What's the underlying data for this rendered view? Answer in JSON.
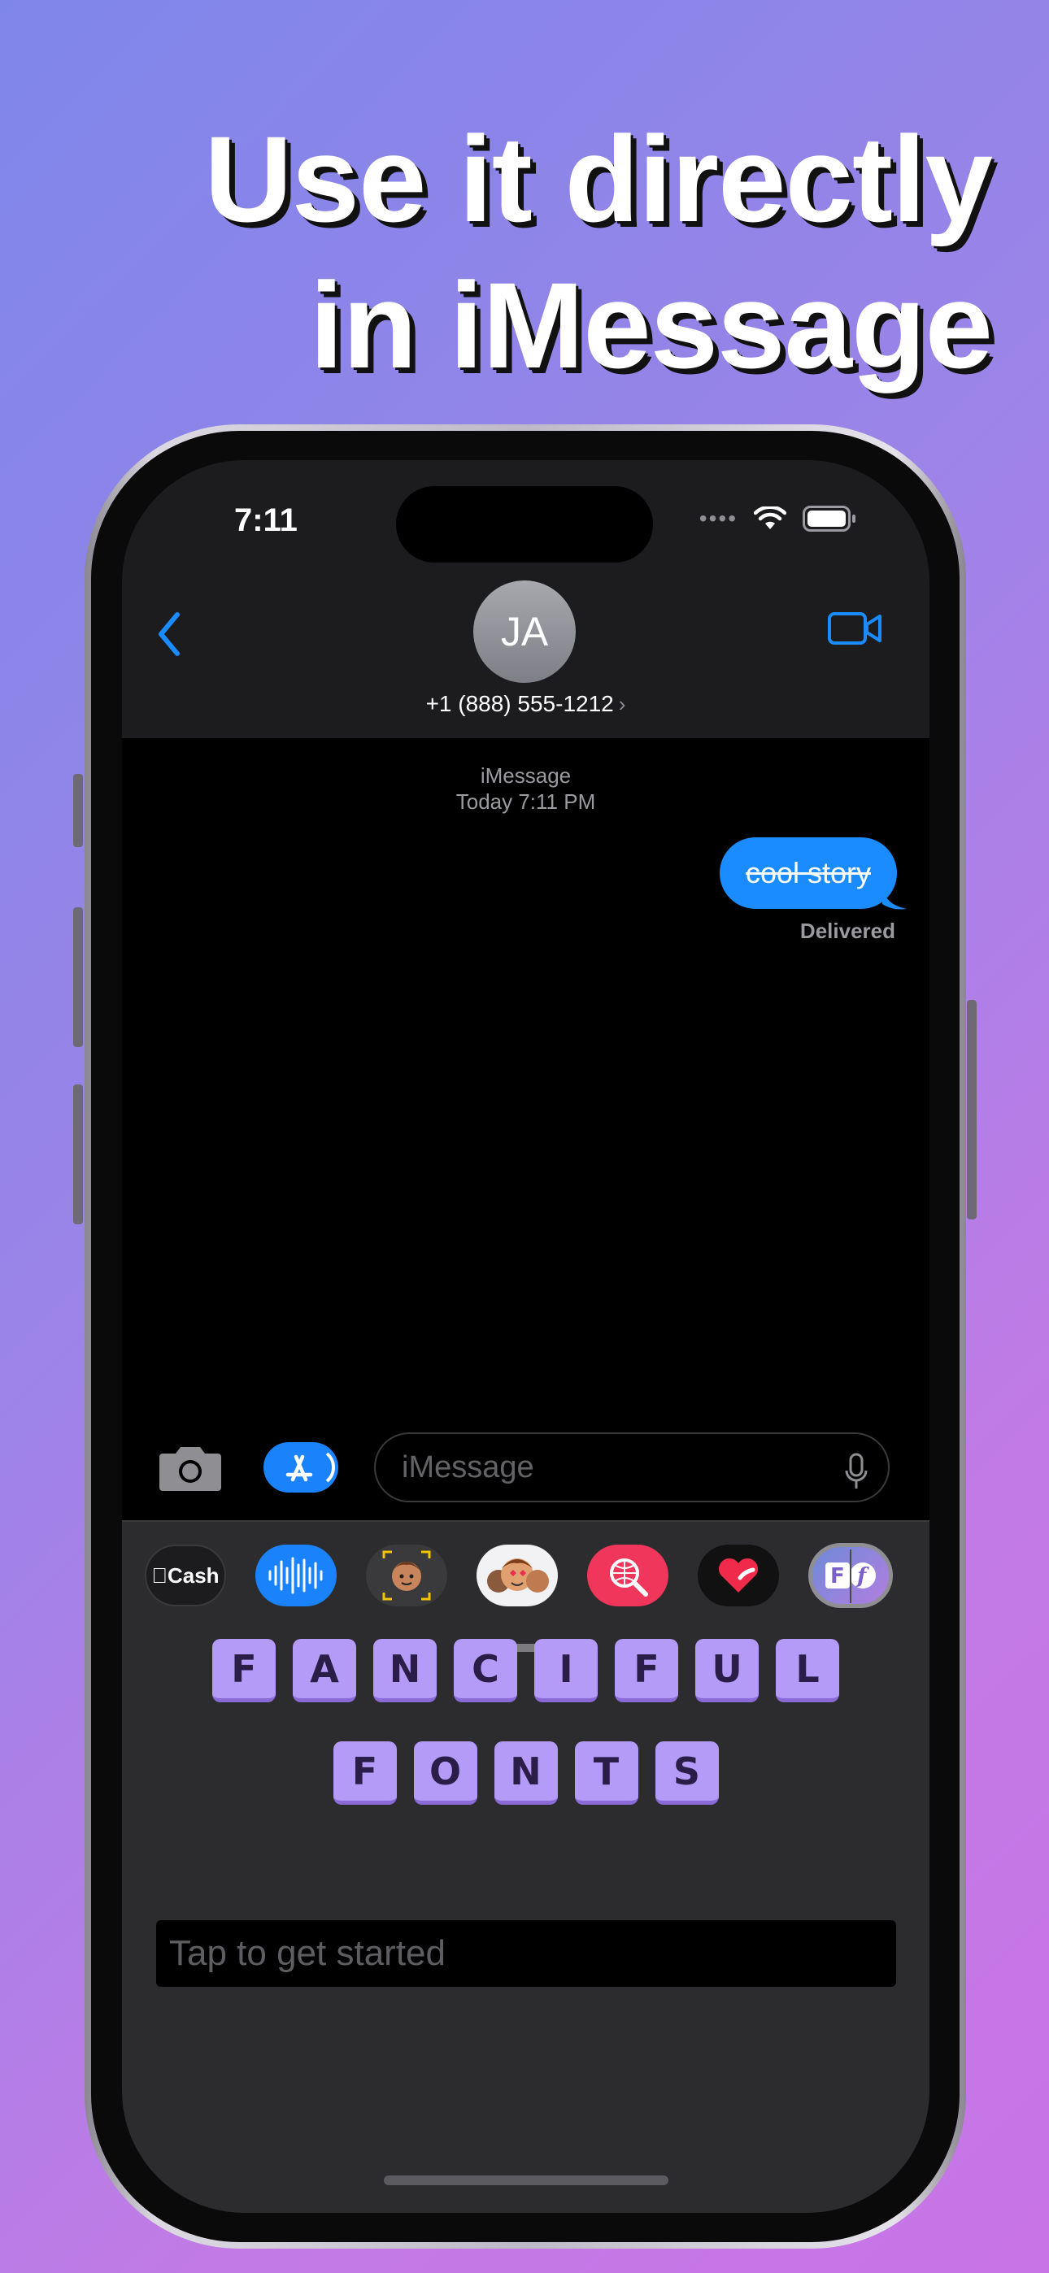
{
  "headline": {
    "line1": "Use it directly",
    "line2": "in iMessage"
  },
  "status_bar": {
    "time": "7:11",
    "icons": [
      "cellular-dots-icon",
      "wifi-icon",
      "battery-icon"
    ]
  },
  "conversation": {
    "avatar_initials": "JA",
    "contact_number": "+1 (888) 555-1212",
    "service": "iMessage",
    "timestamp": "Today 7:11 PM",
    "message": "cool story",
    "delivery_status": "Delivered"
  },
  "compose": {
    "placeholder": "iMessage"
  },
  "app_drawer": {
    "apps": [
      {
        "name": "apple-cash",
        "label": "Cash"
      },
      {
        "name": "audio-messages"
      },
      {
        "name": "memoji"
      },
      {
        "name": "memoji-stickers"
      },
      {
        "name": "images-search"
      },
      {
        "name": "digital-touch"
      },
      {
        "name": "fancy-fonts"
      }
    ]
  },
  "fancy_fonts": {
    "row1": [
      "F",
      "A",
      "N",
      "C",
      "I",
      "F",
      "U",
      "L"
    ],
    "row2": [
      "F",
      "O",
      "N",
      "T",
      "S"
    ],
    "input_placeholder": "Tap to get started"
  },
  "colors": {
    "accent_blue": "#1a8cff",
    "tile_purple": "#b39bf7",
    "background_start": "#7f86ea",
    "background_end": "#c874e6"
  }
}
